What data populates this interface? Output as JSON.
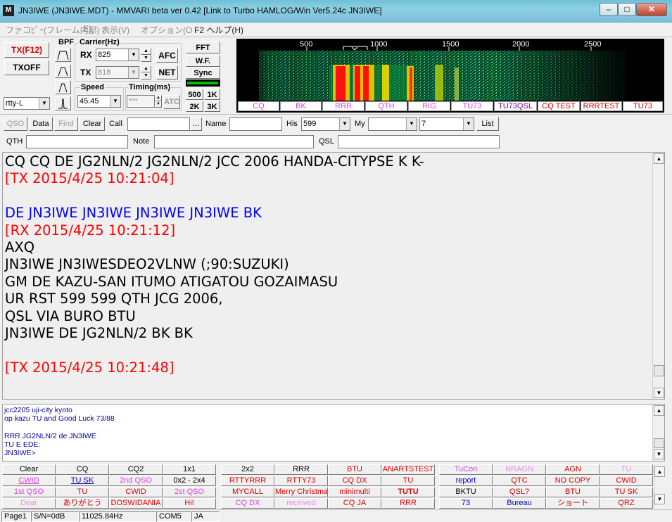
{
  "window": {
    "icon_text": "M",
    "title": "JN3IWE (JN3IWE.MDT) - MMVARI beta ver 0.42 [Link to Turbo HAMLOG/Win Ver5.24c JN3IWE]",
    "minimize": "–",
    "maximize": "□",
    "close": "✕"
  },
  "menu": {
    "file": "ファコﾋﾟｰ(フレーム内部)",
    "edit": "E)",
    "view": "表示(V)",
    "options": "オプション(O",
    "help": "F2 ヘルプ(H)"
  },
  "controls": {
    "tx_button": "TX(F12)",
    "txoff_button": "TXOFF",
    "mode_value": "rtty-L",
    "bpf_label": "BPF",
    "carrier_label": "Carrier(Hz)",
    "rx_label": "RX",
    "rx_value": "825",
    "tx_label": "TX",
    "tx_value": "818",
    "afc_button": "AFC",
    "net_button": "NET",
    "speed_label": "Speed",
    "speed_value": "45.45",
    "timing_label": "Timing(ms)",
    "timing_value": "***",
    "atc_button": "ATC",
    "fft_button": "FFT",
    "wf_button": "W.F.",
    "sync_button": "Sync",
    "span_500": "500",
    "span_1k": "1K",
    "span_2k": "2K",
    "span_3k": "3K"
  },
  "spectrum": {
    "scale": [
      "500",
      "1000",
      "1500",
      "2000",
      "2500"
    ],
    "macros": [
      {
        "label": "CQ",
        "color": "#e040e0"
      },
      {
        "label": "BK",
        "color": "#e040e0"
      },
      {
        "label": "RRR",
        "color": "#e040e0"
      },
      {
        "label": "QTH",
        "color": "#e040e0"
      },
      {
        "label": "RIG",
        "color": "#e040e0"
      },
      {
        "label": "TU73",
        "color": "#e040e0"
      },
      {
        "label": "TU73QSL",
        "color": "#8000a0"
      },
      {
        "label": "CQ TEST",
        "color": "#e00000"
      },
      {
        "label": "RRRTEST",
        "color": "#e00000"
      },
      {
        "label": "TU73",
        "color": "#e00000"
      }
    ]
  },
  "toolbar": {
    "qso": "QSO",
    "data": "Data",
    "find": "Find",
    "clear": "Clear",
    "call_label": "Call",
    "call_value": "",
    "browse": "...",
    "name_label": "Name",
    "name_value": "",
    "his_label": "His",
    "his_value": "599",
    "my_label": "My",
    "my_value": "",
    "power_value": "7",
    "list": "List",
    "qth_label": "QTH",
    "note_label": "Note",
    "qsl_label": "QSL"
  },
  "rx_text": [
    {
      "text": "CQ CQ DE JG2NLN/2 JG2NLN/2 JCC 2006 HANDA-CITYPSE K K-",
      "color": "#000000"
    },
    {
      "text": "[TX 2015/4/25 10:21:04]",
      "color": "#ff0000"
    },
    {
      "text": "",
      "color": "#000000"
    },
    {
      "text": "DE JN3IWE JN3IWE JN3IWE JN3IWE BK",
      "color": "#0000ff"
    },
    {
      "text": "[RX 2015/4/25 10:21:12]",
      "color": "#ff0000"
    },
    {
      "text": "AXQ",
      "color": "#000000"
    },
    {
      "text": "JN3IWE JN3IWESDEO2VLNW (;90:SUZUKI)",
      "color": "#000000"
    },
    {
      "text": "GM DE KAZU-SAN  ITUMO ATIGATOU GOZAIMASU",
      "color": "#000000"
    },
    {
      "text": "UR RST 599 599 QTH JCG 2006,",
      "color": "#000000"
    },
    {
      "text": "QSL VIA BURO    BTU",
      "color": "#000000"
    },
    {
      "text": "JN3IWE DE JG2NLN/2  BK BK",
      "color": "#000000"
    },
    {
      "text": "",
      "color": "#000000"
    },
    {
      "text": "[TX 2015/4/25 10:21:48]",
      "color": "#ff0000"
    }
  ],
  "tx_text": [
    "jcc2205 uji-city kyoto",
    "op kazu TU and Good Luck 73/88",
    "",
    "RRR JG2NLN/2 de JN3IWE",
    "TU E EDE:",
    "JN3IWE>"
  ],
  "macro_rows": [
    [
      {
        "label": "Clear",
        "color": "#000000"
      },
      {
        "label": "CQ",
        "color": "#000000"
      },
      {
        "label": "CQ2",
        "color": "#000000"
      },
      {
        "label": "1x1",
        "color": "#000000"
      },
      {
        "label": "2x2",
        "color": "#000000"
      },
      {
        "label": "RRR",
        "color": "#000000"
      },
      {
        "label": "BTU",
        "color": "#e00000"
      },
      {
        "label": "ANARTSTEST",
        "color": "#e00000"
      },
      {
        "label": "TuCon",
        "color": "#e040e0"
      },
      {
        "label": "NRAGN",
        "color": "#e890e8"
      },
      {
        "label": "AGN",
        "color": "#e00000"
      },
      {
        "label": "TU",
        "color": "#e890e8"
      }
    ],
    [
      {
        "label": "CWID",
        "color": "#e040e0"
      },
      {
        "label": "TU SK",
        "color": "#0000c0"
      },
      {
        "label": "2nd QSO",
        "color": "#e040e0"
      },
      {
        "label": "0x2 - 2x4",
        "color": "#000000"
      },
      {
        "label": "RTTYRRR",
        "color": "#e00000"
      },
      {
        "label": "RTTY73",
        "color": "#e00000"
      },
      {
        "label": "CQ DX",
        "color": "#e00000"
      },
      {
        "label": "TU",
        "color": "#e00000"
      },
      {
        "label": "report",
        "color": "#0000c0"
      },
      {
        "label": "QTC",
        "color": "#e00000"
      },
      {
        "label": "NO COPY",
        "color": "#e00000"
      },
      {
        "label": "CWID",
        "color": "#e00000"
      }
    ],
    [
      {
        "label": "1st QSO",
        "color": "#e040e0"
      },
      {
        "label": "TU",
        "color": "#e00000"
      },
      {
        "label": "CWID",
        "color": "#e00000"
      },
      {
        "label": "2st QSO",
        "color": "#e040e0"
      },
      {
        "label": "MYCALL",
        "color": "#e00000"
      },
      {
        "label": "Merry Christma",
        "color": "#e00000"
      },
      {
        "label": "minimulti",
        "color": "#e00000"
      },
      {
        "label": "TUTU",
        "color": "#e00000"
      },
      {
        "label": "BKTU",
        "color": "#000000"
      },
      {
        "label": "QSL?",
        "color": "#e00000"
      },
      {
        "label": "BTU",
        "color": "#e00000"
      },
      {
        "label": "TU SK",
        "color": "#e00000"
      }
    ],
    [
      {
        "label": "Dear",
        "color": "#e890e8"
      },
      {
        "label": "ありがとう",
        "color": "#e00000"
      },
      {
        "label": "DOSWIDANIA",
        "color": "#e00000"
      },
      {
        "label": "Hi!",
        "color": "#e00000"
      },
      {
        "label": "CQ DX",
        "color": "#e040e0"
      },
      {
        "label": "received",
        "color": "#e890e8"
      },
      {
        "label": "CQ JA",
        "color": "#e00000"
      },
      {
        "label": "RRR",
        "color": "#e00000"
      },
      {
        "label": "73",
        "color": "#0000c0"
      },
      {
        "label": "Bureau",
        "color": "#0000c0"
      },
      {
        "label": "ショート",
        "color": "#e00000"
      },
      {
        "label": "QRZ",
        "color": "#e00000"
      }
    ]
  ],
  "status": {
    "page": "Page1",
    "snr": "S/N=0dB",
    "freq": "11025.84Hz",
    "port": "COM5",
    "lang": "JA"
  }
}
